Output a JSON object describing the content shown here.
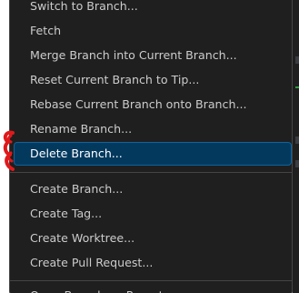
{
  "context_menu": {
    "items_group_1": [
      {
        "label": "Switch to Branch..."
      },
      {
        "label": "Fetch"
      },
      {
        "label": "Merge Branch into Current Branch..."
      },
      {
        "label": "Reset Current Branch to Tip..."
      },
      {
        "label": "Rebase Current Branch onto Branch..."
      },
      {
        "label": "Rename Branch..."
      },
      {
        "label": "Delete Branch..."
      }
    ],
    "selected_label": "Delete Branch...",
    "items_group_2": [
      {
        "label": "Create Branch..."
      },
      {
        "label": "Create Tag..."
      },
      {
        "label": "Create Worktree..."
      },
      {
        "label": "Create Pull Request..."
      }
    ],
    "items_group_3": [
      {
        "label": "Open Branch on Remote"
      }
    ]
  },
  "colors": {
    "menu_background": "#1f1f1f",
    "menu_text": "#cccccc",
    "selected_background": "#04395e",
    "selected_border": "#0e639c",
    "separator": "#454545",
    "annotation": "#e0191b"
  }
}
